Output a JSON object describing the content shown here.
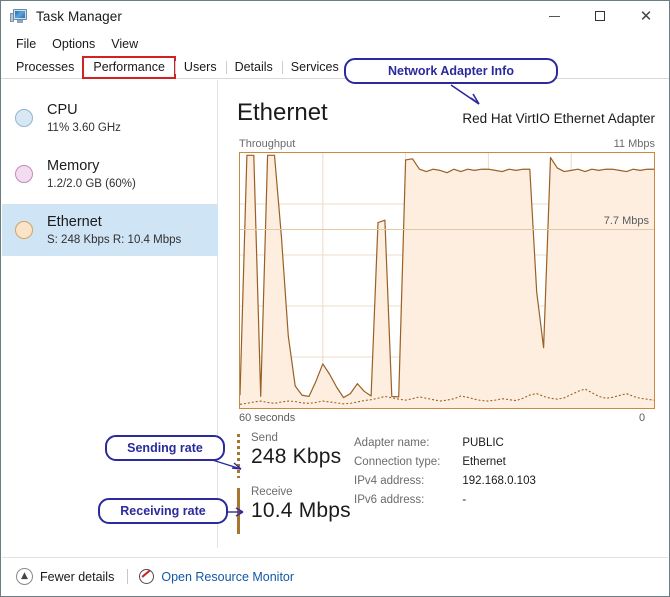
{
  "window": {
    "title": "Task Manager",
    "icon": "task-manager-icon",
    "controls": {
      "minimize": "—",
      "maximize": "☐",
      "close": "✕"
    }
  },
  "menu": {
    "items": [
      "File",
      "Options",
      "View"
    ]
  },
  "tabs": {
    "items": [
      "Processes",
      "Performance",
      "Users",
      "Details",
      "Services"
    ],
    "active": "Performance"
  },
  "sidebar": {
    "items": [
      {
        "name": "CPU",
        "sub": "11%  3.60 GHz",
        "color": "#d7e7f3",
        "border": "#8fb6d3",
        "selected": false
      },
      {
        "name": "Memory",
        "sub": "1.2/2.0 GB (60%)",
        "color": "#f4dcf0",
        "border": "#c489c0",
        "selected": false
      },
      {
        "name": "Ethernet",
        "sub": "S: 248 Kbps R: 10.4 Mbps",
        "color": "#fbe3c8",
        "border": "#d2a362",
        "selected": true
      }
    ]
  },
  "main": {
    "heading": "Ethernet",
    "adapter_description": "Red Hat VirtIO Ethernet Adapter",
    "graph_label": "Throughput",
    "scale_max": "11 Mbps",
    "inner_scale_label": "7.7 Mbps",
    "axis_left": "60 seconds",
    "axis_right": "0"
  },
  "stats": {
    "send": {
      "label": "Send",
      "value": "248 Kbps",
      "marker": "dotted"
    },
    "receive": {
      "label": "Receive",
      "value": "10.4 Mbps",
      "marker": "solid"
    }
  },
  "adapter_info": {
    "rows": [
      {
        "key": "Adapter name:",
        "value": "PUBLIC"
      },
      {
        "key": "Connection type:",
        "value": "Ethernet"
      },
      {
        "key": "IPv4 address:",
        "value": "192.168.0.103"
      },
      {
        "key": "IPv6 address:",
        "value": "-"
      }
    ]
  },
  "statusbar": {
    "fewer_details": "Fewer details",
    "fewer_details_icon": "chevron-up-circle-icon",
    "open_resource_monitor": "Open Resource Monitor",
    "resource_monitor_icon": "gauge-icon",
    "link_color": "#1258a8"
  },
  "annotations": [
    {
      "id": "network-adapter-info",
      "text": "Network Adapter Info",
      "color": "#2a2a9c"
    },
    {
      "id": "sending-rate",
      "text": "Sending rate",
      "color": "#2a2a9c"
    },
    {
      "id": "receiving-rate",
      "text": "Receiving rate",
      "color": "#2a2a9c"
    }
  ],
  "chart_data": {
    "type": "area",
    "title": "Throughput",
    "xlabel": "",
    "ylabel": "",
    "ylim": [
      0,
      11
    ],
    "yunit": "Mbps",
    "xlim_labels": [
      "60 seconds",
      "0"
    ],
    "grid": true,
    "gridlines_y": 5,
    "gridlines_x": 5,
    "reference_line": {
      "value": 7.7,
      "label": "7.7 Mbps"
    },
    "line_color": "#9a5f23",
    "fill_color": "#fdeee0",
    "series": [
      {
        "name": "Receive",
        "style": "solid",
        "values": [
          0.55,
          10.9,
          10.9,
          0.5,
          10.9,
          10.9,
          7.4,
          3.1,
          0.95,
          0.55,
          0.5,
          1.15,
          1.9,
          1.45,
          0.9,
          0.45,
          0.62,
          1.05,
          0.72,
          0.52,
          8.0,
          8.1,
          0.5,
          0.48,
          10.7,
          10.75,
          10.3,
          10.2,
          10.3,
          10.25,
          10.15,
          10.3,
          10.2,
          10.3,
          10.25,
          10.3,
          10.3,
          10.25,
          10.2,
          10.3,
          10.25,
          10.3,
          10.3,
          5.0,
          2.6,
          10.8,
          10.35,
          10.2,
          10.25,
          10.3,
          10.2,
          10.3,
          10.25,
          10.3,
          10.3,
          10.25,
          10.2,
          10.3,
          10.25,
          10.3,
          10.3
        ]
      },
      {
        "name": "Send",
        "style": "dotted",
        "values": [
          0.16,
          0.2,
          0.26,
          0.3,
          0.24,
          0.2,
          0.26,
          0.3,
          0.28,
          0.22,
          0.2,
          0.24,
          0.3,
          0.26,
          0.22,
          0.18,
          0.2,
          0.26,
          0.32,
          0.36,
          0.42,
          0.5,
          0.44,
          0.38,
          0.34,
          0.4,
          0.48,
          0.42,
          0.36,
          0.3,
          0.34,
          0.4,
          0.52,
          0.46,
          0.38,
          0.32,
          0.3,
          0.34,
          0.4,
          0.36,
          0.32,
          0.42,
          0.56,
          0.62,
          0.5,
          0.42,
          0.38,
          0.44,
          0.58,
          0.72,
          0.82,
          0.66,
          0.5,
          0.42,
          0.46,
          0.54,
          0.62,
          0.5,
          0.42,
          0.38,
          0.34
        ]
      }
    ]
  }
}
